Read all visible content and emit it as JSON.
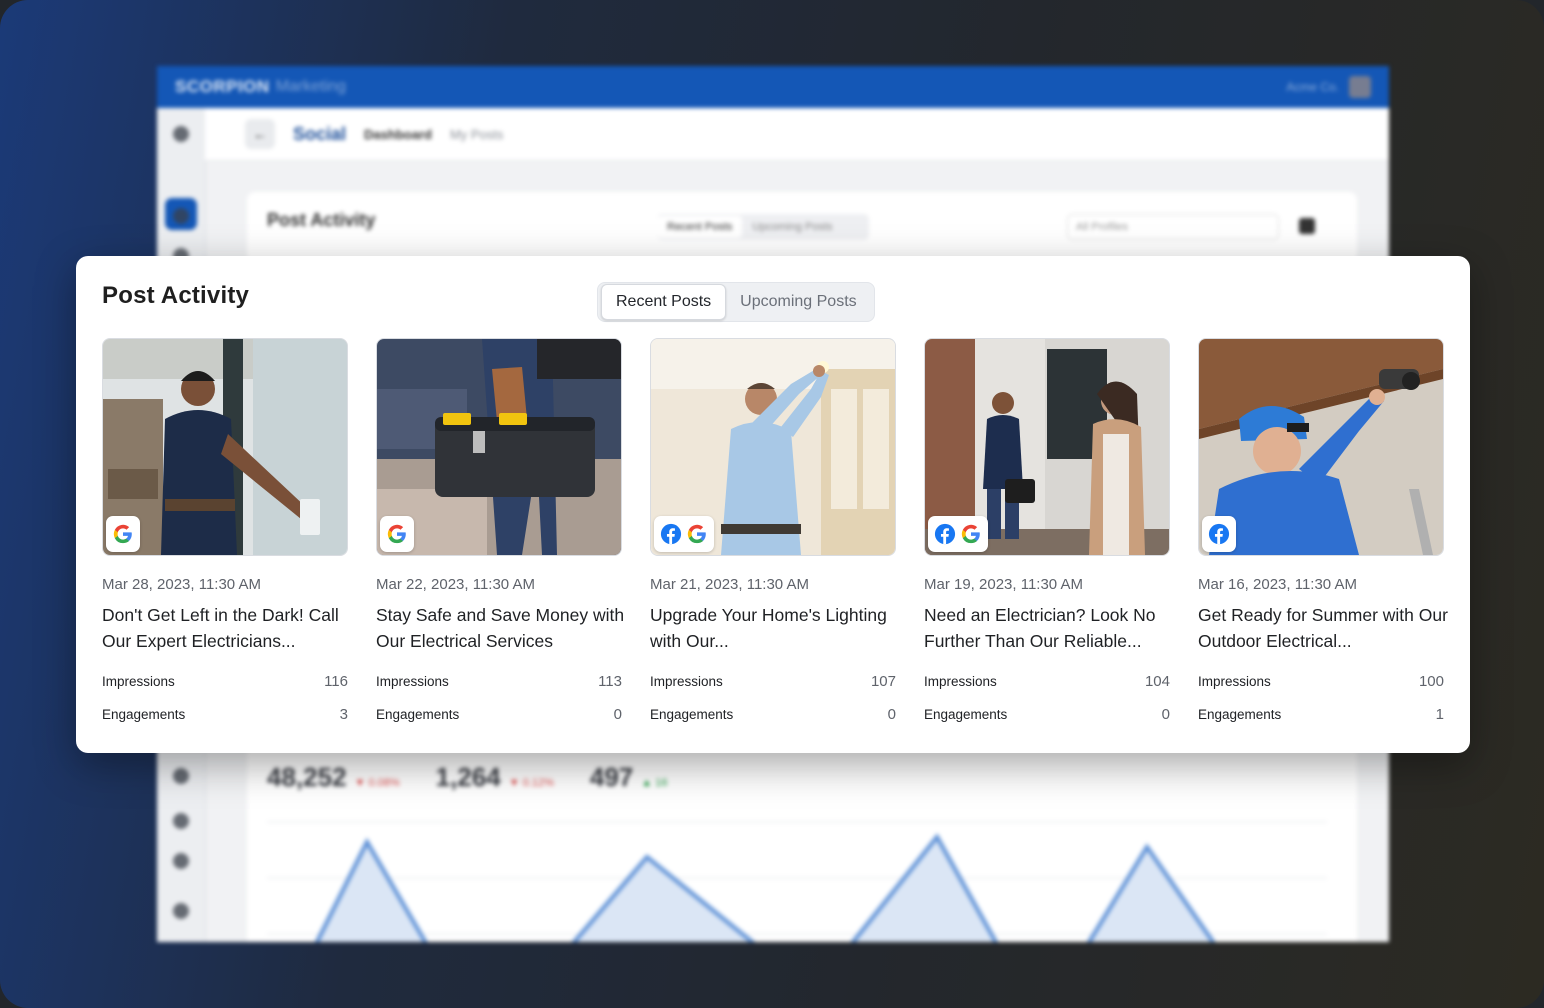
{
  "background_app": {
    "logo": "SCORPION",
    "logo_suffix": "Marketing",
    "user_name": "Acme Co.",
    "page_title": "Social",
    "nav": [
      "Dashboard",
      "My Posts"
    ],
    "card_title": "Post Activity",
    "tabs": [
      "Recent Posts",
      "Upcoming Posts"
    ],
    "profile_select": "All Profiles",
    "stats": [
      {
        "value": "48,252",
        "delta": "▼ 0.08%"
      },
      {
        "value": "1,264",
        "delta": "▼ 0.12%"
      },
      {
        "value": "497",
        "delta": "▲ 16"
      }
    ]
  },
  "post_activity": {
    "title": "Post Activity",
    "tabs": [
      {
        "label": "Recent Posts",
        "active": true
      },
      {
        "label": "Upcoming Posts",
        "active": false
      }
    ],
    "impressions_label": "Impressions",
    "engagements_label": "Engagements",
    "posts": [
      {
        "date": "Mar 28, 2023, 11:30 AM",
        "headline": "Don't Get Left in the Dark! Call Our Expert Electricians...",
        "platforms": [
          "google"
        ],
        "impressions": "116",
        "engagements": "3",
        "image": "electrician pointing at wall outlet"
      },
      {
        "date": "Mar 22, 2023, 11:30 AM",
        "headline": "Stay Safe and Save Money with Our Electrical Services",
        "platforms": [
          "google"
        ],
        "impressions": "113",
        "engagements": "0",
        "image": "man carrying toolbox"
      },
      {
        "date": "Mar 21, 2023, 11:30 AM",
        "headline": "Upgrade Your Home's Lighting with Our...",
        "platforms": [
          "facebook",
          "google"
        ],
        "impressions": "107",
        "engagements": "0",
        "image": "electrician installing ceiling light"
      },
      {
        "date": "Mar 19, 2023, 11:30 AM",
        "headline": "Need an Electrician? Look No Further Than Our Reliable...",
        "platforms": [
          "facebook",
          "google"
        ],
        "impressions": "104",
        "engagements": "0",
        "image": "electrician at front door greeting homeowner"
      },
      {
        "date": "Mar 16, 2023, 11:30 AM",
        "headline": "Get Ready for Summer with Our Outdoor Electrical...",
        "platforms": [
          "facebook"
        ],
        "impressions": "100",
        "engagements": "1",
        "image": "technician installing outdoor security camera"
      }
    ]
  },
  "colors": {
    "brand_blue": "#1457b6",
    "facebook_blue": "#1877f2",
    "google_blue": "#4285f4",
    "google_red": "#ea4335",
    "google_yellow": "#fbbc05",
    "google_green": "#34a853"
  }
}
